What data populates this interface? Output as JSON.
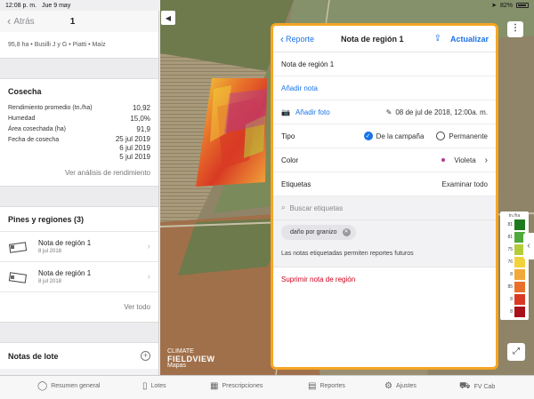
{
  "status": {
    "time": "12:08 p. m.",
    "date": "Jue 9 may",
    "battery": "82%"
  },
  "left": {
    "back_label": "Atrás",
    "title": "1",
    "field_info": "95,8 ha • Busilli J y G • Piatti • Maíz",
    "harvest": {
      "heading": "Cosecha",
      "stats": [
        {
          "label": "Rendimiento promedio (tn./ha)",
          "value": "10,92"
        },
        {
          "label": "Humedad",
          "value": "15,0%"
        },
        {
          "label": "Área cosechada (ha)",
          "value": "91,9"
        }
      ],
      "dates_label": "Fecha de cosecha",
      "dates": [
        "25 jul 2019",
        "6 jul 2019",
        "5 jul 2019"
      ],
      "analysis_link": "Ver análisis de rendimiento"
    },
    "pins": {
      "heading": "Pines y regiones (3)",
      "items": [
        {
          "title": "Nota de región 1",
          "date": "8 jul 2018"
        },
        {
          "title": "Nota de región 1",
          "date": "8 jul 2018"
        }
      ],
      "view_all": "Ver todo"
    },
    "lot_notes": {
      "heading": "Notas de lote"
    }
  },
  "map": {
    "logo_line1": "CLIMATE",
    "logo_line2": "FIELDVIEW",
    "logo_line3": "Mapas",
    "legend_header": "tn./ha",
    "legend": [
      {
        "label": "81",
        "color": "#1e7a1e"
      },
      {
        "label": "81",
        "color": "#4fa83a"
      },
      {
        "label": "75",
        "color": "#b5cc3a"
      },
      {
        "label": "76",
        "color": "#f2d23a"
      },
      {
        "label": "8",
        "color": "#f2a93a"
      },
      {
        "label": "85",
        "color": "#e8702a"
      },
      {
        "label": "8",
        "color": "#d83a24"
      },
      {
        "label": "8",
        "color": "#a8101a"
      }
    ]
  },
  "note": {
    "back_label": "Reporte",
    "title": "Nota de región 1",
    "update_label": "Actualizar",
    "note_name": "Nota de región 1",
    "add_note": "Añadir nota",
    "add_photo": "Añadir foto",
    "datetime": "08 de jul de 2018, 12:00a. m.",
    "type_label": "Tipo",
    "type_option_1": "De la campaña",
    "type_option_2": "Permanente",
    "color_label": "Color",
    "color_value": "Violeta",
    "tags_label": "Etiquetas",
    "browse_all": "Examinar todo",
    "search_placeholder": "Buscar etiquetas",
    "tag_chip": "daño por granizo",
    "hint": "Las notas etiquetadas permiten reportes futuros",
    "delete": "Suprimir nota de región"
  },
  "tabs": [
    {
      "label": "Resumen general",
      "icon": "circle-icon"
    },
    {
      "label": "Lotes",
      "icon": "field-icon"
    },
    {
      "label": "Prescripciones",
      "icon": "prescription-icon"
    },
    {
      "label": "Reportes",
      "icon": "report-icon"
    },
    {
      "label": "Ajustes",
      "icon": "gear-icon"
    },
    {
      "label": "FV Cab",
      "icon": "tractor-icon"
    }
  ]
}
